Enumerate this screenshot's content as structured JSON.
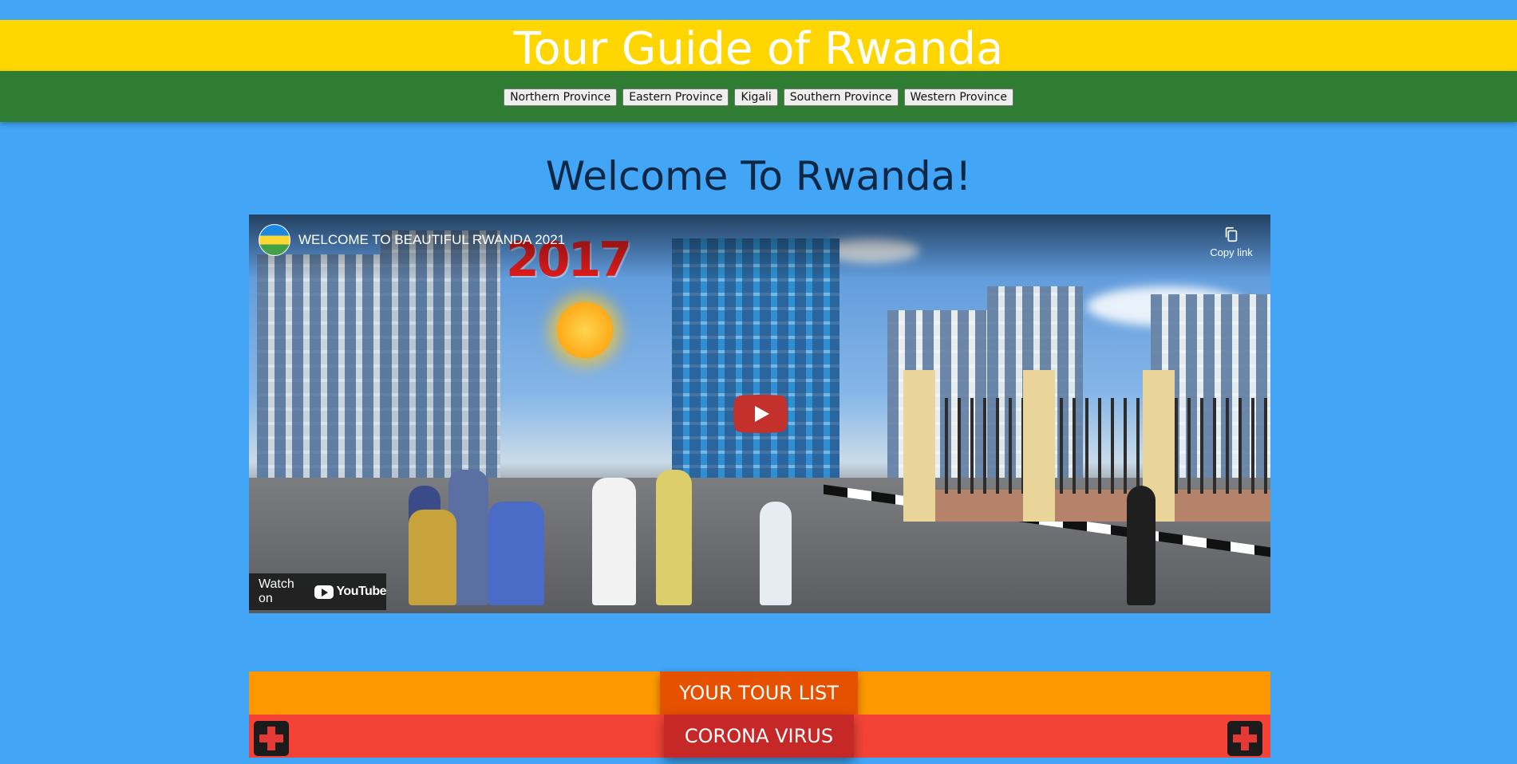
{
  "header": {
    "site_title": "Tour Guide of Rwanda",
    "nav": [
      {
        "label": "Northern Province"
      },
      {
        "label": "Eastern Province"
      },
      {
        "label": "Kigali"
      },
      {
        "label": "Southern Province"
      },
      {
        "label": "Western Province"
      }
    ]
  },
  "main": {
    "welcome_heading": "Welcome To Rwanda!"
  },
  "video": {
    "title": "WELCOME TO BEAUTIFUL RWANDA 2021",
    "copy_link_label": "Copy link",
    "watch_on_label": "Watch on",
    "youtube_label": "YouTube",
    "overlay_year": "2017"
  },
  "sections": {
    "tour_list_label": "YOUR TOUR LIST",
    "corona_label": "CORONA VIRUS"
  },
  "colors": {
    "page_background": "#42a5f5",
    "title_band": "#ffd600",
    "nav_band": "#2e7d32",
    "tour_bar": "#ff9800",
    "tour_button": "#e65100",
    "corona_bar": "#f44336",
    "corona_button": "#c62828"
  },
  "icons": {
    "play": "youtube-play-icon",
    "copy": "copy-link-icon",
    "medical": "medical-cross-icon"
  }
}
